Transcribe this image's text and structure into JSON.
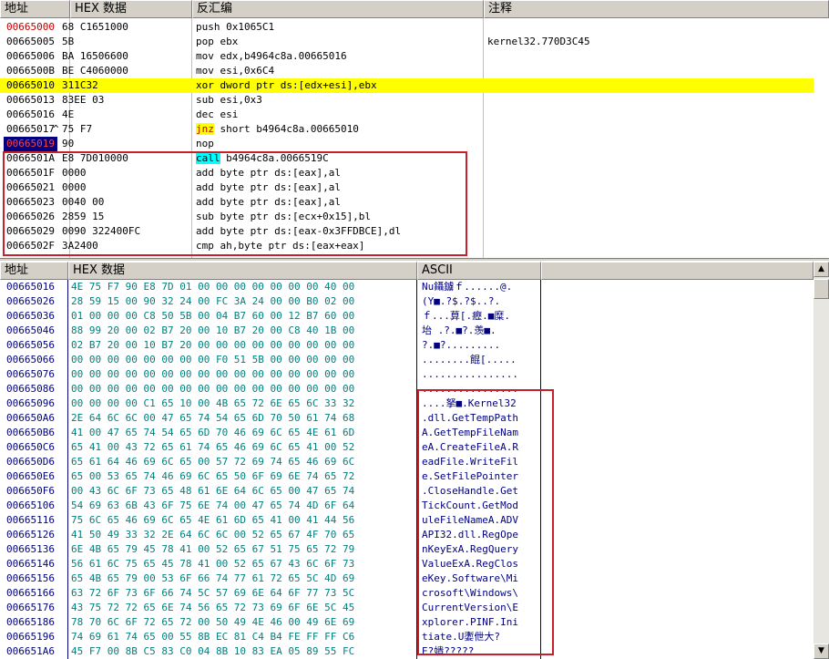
{
  "disasm": {
    "headers": {
      "address": "地址",
      "hex": "HEX 数据",
      "disassembly": "反汇编",
      "comment": "注释"
    },
    "rows": [
      {
        "addr": "00665000",
        "hex": "68 C1651000",
        "asm": "push 0x1065C1",
        "comment": "",
        "addr_style": "red"
      },
      {
        "addr": "00665005",
        "hex": "5B",
        "asm": "pop ebx",
        "comment": "kernel32.770D3C45",
        "addr_style": ""
      },
      {
        "addr": "00665006",
        "hex": "BA 16506600",
        "asm": "mov edx,b4964c8a.00665016",
        "comment": "",
        "addr_style": ""
      },
      {
        "addr": "0066500B",
        "hex": "BE C4060000",
        "asm": "mov esi,0x6C4",
        "comment": "",
        "addr_style": ""
      },
      {
        "addr": "00665010",
        "hex": "311C32",
        "asm": "xor dword ptr ds:[edx+esi],ebx",
        "comment": "",
        "addr_style": "",
        "row_style": "yellow"
      },
      {
        "addr": "00665013",
        "hex": "83EE 03",
        "asm": "sub esi,0x3",
        "comment": "",
        "addr_style": ""
      },
      {
        "addr": "00665016",
        "hex": "4E",
        "asm": "dec esi",
        "comment": "",
        "addr_style": ""
      },
      {
        "addr": "00665017",
        "hex": "75 F7",
        "asm": "short b4964c8a.00665010",
        "kw": "jnz",
        "kw_style": "jnz",
        "jump_mark": "^",
        "comment": "",
        "addr_style": ""
      },
      {
        "addr": "00665019",
        "hex": "90",
        "asm": "nop",
        "comment": "",
        "addr_style": "selected"
      },
      {
        "addr": "0066501A",
        "hex": "E8 7D010000",
        "asm": "b4964c8a.0066519C",
        "kw": "call",
        "kw_style": "call",
        "comment": "",
        "addr_style": ""
      },
      {
        "addr": "0066501F",
        "hex": "0000",
        "asm": "add byte ptr ds:[eax],al",
        "comment": "",
        "addr_style": ""
      },
      {
        "addr": "00665021",
        "hex": "0000",
        "asm": "add byte ptr ds:[eax],al",
        "comment": "",
        "addr_style": ""
      },
      {
        "addr": "00665023",
        "hex": "0040 00",
        "asm": "add byte ptr ds:[eax],al",
        "comment": "",
        "addr_style": ""
      },
      {
        "addr": "00665026",
        "hex": "2859 15",
        "asm": "sub byte ptr ds:[ecx+0x15],bl",
        "comment": "",
        "addr_style": ""
      },
      {
        "addr": "00665029",
        "hex": "0090 322400FC",
        "asm": "add byte ptr ds:[eax-0x3FFDBCE],dl",
        "comment": "",
        "addr_style": ""
      },
      {
        "addr": "0066502F",
        "hex": "3A2400",
        "asm": "cmp ah,byte ptr ds:[eax+eax]",
        "comment": "",
        "addr_style": ""
      }
    ]
  },
  "dump": {
    "headers": {
      "address": "地址",
      "hex": "HEX 数据",
      "ascii": "ASCII"
    },
    "rows": [
      {
        "addr": "00665016",
        "bytes": "4E 75 F7 90 E8 7D 01 00 00 00 00 00 00 00 40 00",
        "ascii": "Nu鑷鐪ｆ......@."
      },
      {
        "addr": "00665026",
        "bytes": "28 59 15 00 90 32 24 00 FC 3A 24 00 00 B0 02 00",
        "ascii": "(Y■.?$.?$..?."
      },
      {
        "addr": "00665036",
        "bytes": "01 00 00 00 C8 50 5B 00 04 B7 60 00 12 B7 60 00",
        "ascii": "ｆ...萛[.癧.■糜."
      },
      {
        "addr": "00665046",
        "bytes": "88 99 20 00 02 B7 20 00 10 B7 20 00 C8 40 1B 00",
        "ascii": "坮 .?.■?.羡■."
      },
      {
        "addr": "00665056",
        "bytes": "02 B7 20 00 10 B7 20 00 00 00 00 00 00 00 00 00",
        "ascii": "?.■?........."
      },
      {
        "addr": "00665066",
        "bytes": "00 00 00 00 00 00 00 00 F0 51 5B 00 00 00 00 00",
        "ascii": "........餛[....."
      },
      {
        "addr": "00665076",
        "bytes": "00 00 00 00 00 00 00 00 00 00 00 00 00 00 00 00",
        "ascii": "................"
      },
      {
        "addr": "00665086",
        "bytes": "00 00 00 00 00 00 00 00 00 00 00 00 00 00 00 00",
        "ascii": "................"
      },
      {
        "addr": "00665096",
        "bytes": "00 00 00 00 C1 65 10 00 4B 65 72 6E 65 6C 33 32",
        "ascii": "....拏■.Kernel32"
      },
      {
        "addr": "006650A6",
        "bytes": "2E 64 6C 6C 00 47 65 74 54 65 6D 70 50 61 74 68",
        "ascii": ".dll.GetTempPath"
      },
      {
        "addr": "006650B6",
        "bytes": "41 00 47 65 74 54 65 6D 70 46 69 6C 65 4E 61 6D",
        "ascii": "A.GetTempFileNam"
      },
      {
        "addr": "006650C6",
        "bytes": "65 41 00 43 72 65 61 74 65 46 69 6C 65 41 00 52",
        "ascii": "eA.CreateFileA.R"
      },
      {
        "addr": "006650D6",
        "bytes": "65 61 64 46 69 6C 65 00 57 72 69 74 65 46 69 6C",
        "ascii": "eadFile.WriteFil"
      },
      {
        "addr": "006650E6",
        "bytes": "65 00 53 65 74 46 69 6C 65 50 6F 69 6E 74 65 72",
        "ascii": "e.SetFilePointer"
      },
      {
        "addr": "006650F6",
        "bytes": "00 43 6C 6F 73 65 48 61 6E 64 6C 65 00 47 65 74",
        "ascii": ".CloseHandle.Get"
      },
      {
        "addr": "00665106",
        "bytes": "54 69 63 6B 43 6F 75 6E 74 00 47 65 74 4D 6F 64",
        "ascii": "TickCount.GetMod"
      },
      {
        "addr": "00665116",
        "bytes": "75 6C 65 46 69 6C 65 4E 61 6D 65 41 00 41 44 56",
        "ascii": "uleFileNameA.ADV"
      },
      {
        "addr": "00665126",
        "bytes": "41 50 49 33 32 2E 64 6C 6C 00 52 65 67 4F 70 65",
        "ascii": "API32.dll.RegOpe"
      },
      {
        "addr": "00665136",
        "bytes": "6E 4B 65 79 45 78 41 00 52 65 67 51 75 65 72 79",
        "ascii": "nKeyExA.RegQuery"
      },
      {
        "addr": "00665146",
        "bytes": "56 61 6C 75 65 45 78 41 00 52 65 67 43 6C 6F 73",
        "ascii": "ValueExA.RegClos"
      },
      {
        "addr": "00665156",
        "bytes": "65 4B 65 79 00 53 6F 66 74 77 61 72 65 5C 4D 69",
        "ascii": "eKey.Software\\Mi"
      },
      {
        "addr": "00665166",
        "bytes": "63 72 6F 73 6F 66 74 5C 57 69 6E 64 6F 77 73 5C",
        "ascii": "crosoft\\Windows\\"
      },
      {
        "addr": "00665176",
        "bytes": "43 75 72 72 65 6E 74 56 65 72 73 69 6F 6E 5C 45",
        "ascii": "CurrentVersion\\E"
      },
      {
        "addr": "00665186",
        "bytes": "78 70 6C 6F 72 65 72 00 50 49 4E 46 00 49 6E 69",
        "ascii": "xplorer.PINF.Ini"
      },
      {
        "addr": "00665196",
        "bytes": "74 69 61 74 65 00 55 8B EC 81 C4 B4 FE FF FF C6",
        "ascii": "tiate.U嬱伳大?"
      },
      {
        "addr": "006651A6",
        "bytes": "45 F7 00 8B C5 83 C0 04 8B 10 83 EA 05 89 55 FC",
        "ascii": "E?嬇?????"
      }
    ]
  },
  "colors": {
    "highlight_row": "#ffff00",
    "red_box": "#c8202a",
    "address_red": "#c00000",
    "selected_bg": "#000080"
  }
}
